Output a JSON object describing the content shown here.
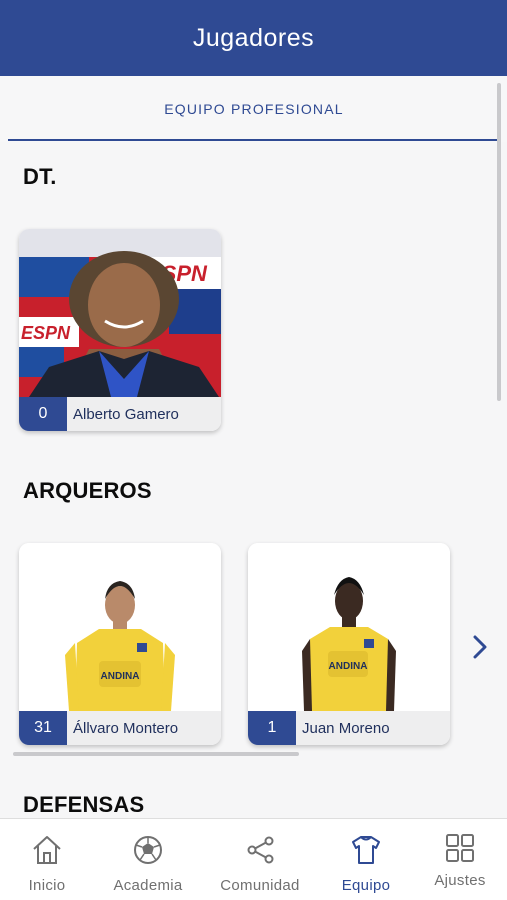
{
  "header": {
    "title": "Jugadores"
  },
  "tabs": [
    {
      "label": "EQUIPO PROFESIONAL",
      "active": true
    }
  ],
  "sections": [
    {
      "title": "DT.",
      "players": [
        {
          "number": "0",
          "name": "Alberto Gamero"
        }
      ]
    },
    {
      "title": "ARQUEROS",
      "players": [
        {
          "number": "31",
          "name": "Állvaro Montero"
        },
        {
          "number": "1",
          "name": "Juan Moreno"
        }
      ]
    },
    {
      "title": "DEFENSAS",
      "players": []
    }
  ],
  "jersey_sponsor": "ANDINA",
  "banner_text": "ESPN",
  "bottom_nav": [
    {
      "label": "Inicio",
      "icon": "home-icon"
    },
    {
      "label": "Academia",
      "icon": "soccer-ball-icon"
    },
    {
      "label": "Comunidad",
      "icon": "share-icon"
    },
    {
      "label": "Equipo",
      "icon": "jersey-icon",
      "active": true
    },
    {
      "label": "Ajustes",
      "icon": "grid-icon"
    }
  ],
  "colors": {
    "primary": "#2f4a93",
    "jersey": "#f2d13b",
    "background": "#f6f6f7"
  }
}
